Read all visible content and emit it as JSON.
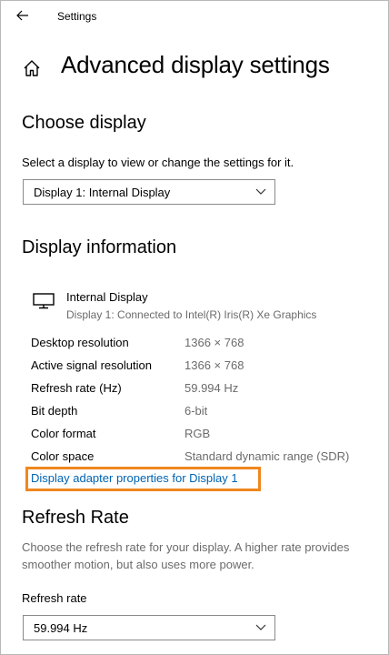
{
  "window": {
    "title": "Settings"
  },
  "page": {
    "title": "Advanced display settings"
  },
  "choose_display": {
    "heading": "Choose display",
    "description": "Select a display to view or change the settings for it.",
    "selected": "Display 1: Internal Display"
  },
  "display_information": {
    "heading": "Display information",
    "display_name": "Internal Display",
    "display_subtitle": "Display 1: Connected to Intel(R) Iris(R) Xe Graphics",
    "rows": [
      {
        "label": "Desktop resolution",
        "value": "1366 × 768"
      },
      {
        "label": "Active signal resolution",
        "value": "1366 × 768"
      },
      {
        "label": "Refresh rate (Hz)",
        "value": "59.994 Hz"
      },
      {
        "label": "Bit depth",
        "value": "6-bit"
      },
      {
        "label": "Color format",
        "value": "RGB"
      },
      {
        "label": "Color space",
        "value": "Standard dynamic range (SDR)"
      }
    ],
    "adapter_link": "Display adapter properties for Display 1"
  },
  "refresh_rate": {
    "heading": "Refresh Rate",
    "description": "Choose the refresh rate for your display. A higher rate provides smoother motion, but also uses more power.",
    "field_label": "Refresh rate",
    "selected": "59.994 Hz"
  },
  "colors": {
    "link": "#0063b1",
    "highlight": "#f0871e",
    "secondary_text": "#6b6b6b"
  },
  "icons": {
    "back": "back-arrow-icon",
    "home": "home-icon",
    "monitor": "monitor-icon",
    "dropdown": "chevron-down-icon"
  }
}
